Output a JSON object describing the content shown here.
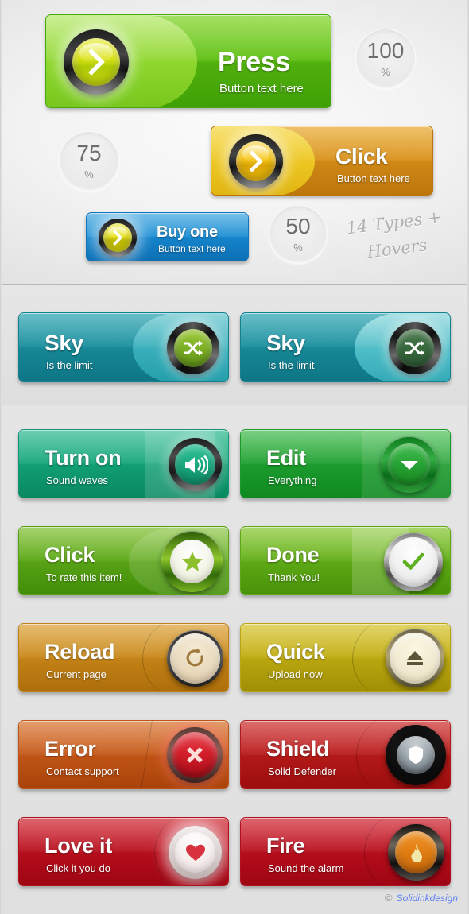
{
  "hero": {
    "buttons": [
      {
        "id": "press",
        "title": "Press",
        "sub": "Button text here",
        "icon": "chevron-right-icon",
        "color": "#5fc014"
      },
      {
        "id": "click",
        "title": "Click",
        "sub": "Button text here",
        "icon": "chevron-right-icon",
        "color": "#d9921c"
      },
      {
        "id": "buy",
        "title": "Buy one",
        "sub": "Button text here",
        "icon": "chevron-right-icon",
        "color": "#1f8fd4"
      }
    ],
    "percent_circles": [
      {
        "value": "100",
        "unit": "%"
      },
      {
        "value": "75",
        "unit": "%"
      },
      {
        "value": "50",
        "unit": "%"
      }
    ],
    "tagline": "14 Types +\nHovers"
  },
  "sky": {
    "buttons": [
      {
        "id": "sky-1",
        "title": "Sky",
        "sub": "Is the limit",
        "icon": "shuffle-icon",
        "state": "normal",
        "color": "#1b8f9e"
      },
      {
        "id": "sky-2",
        "title": "Sky",
        "sub": "Is the limit",
        "icon": "shuffle-icon",
        "state": "hover",
        "color": "#1b8f9e"
      }
    ]
  },
  "grid": {
    "buttons": [
      {
        "id": "turnon",
        "title": "Turn on",
        "sub": "Sound waves",
        "icon": "speaker-icon",
        "color": "#18a87c"
      },
      {
        "id": "edit",
        "title": "Edit",
        "sub": "Everything",
        "icon": "chevron-down-icon",
        "color": "#22a233"
      },
      {
        "id": "clickrate",
        "title": "Click",
        "sub": "To rate this item!",
        "icon": "star-icon",
        "color": "#5da918"
      },
      {
        "id": "done",
        "title": "Done",
        "sub": "Thank You!",
        "icon": "check-icon",
        "color": "#64b018"
      },
      {
        "id": "reload",
        "title": "Reload",
        "sub": "Current page",
        "icon": "refresh-icon",
        "color": "#ca8a1d"
      },
      {
        "id": "quick",
        "title": "Quick",
        "sub": "Upload now",
        "icon": "eject-icon",
        "color": "#c2ae14"
      },
      {
        "id": "error",
        "title": "Error",
        "sub": "Contact support",
        "icon": "close-x-icon",
        "color": "#c75b1b"
      },
      {
        "id": "shield",
        "title": "Shield",
        "sub": "Solid Defender",
        "icon": "shield-icon",
        "color": "#bb1d1d"
      },
      {
        "id": "loveit",
        "title": "Love it",
        "sub": "Click it you do",
        "icon": "heart-icon",
        "color": "#bb1220"
      },
      {
        "id": "fire",
        "title": "Fire",
        "sub": "Sound the alarm",
        "icon": "flame-icon",
        "color": "#bb1220"
      }
    ]
  },
  "footer": {
    "copyright_symbol": "©",
    "brand": "Solidinkdesign",
    "color": "#5d7ff5"
  }
}
